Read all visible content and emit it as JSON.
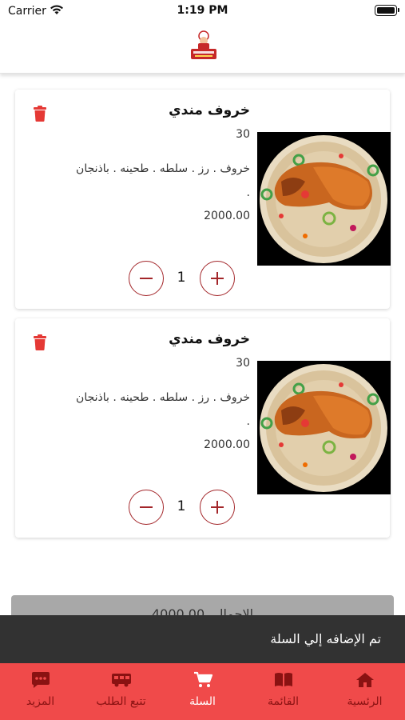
{
  "status_bar": {
    "carrier": "Carrier",
    "time": "1:19 PM"
  },
  "header": {
    "logo_icon": "restaurant-logo"
  },
  "cart_items": [
    {
      "title": "خروف مندي",
      "qty_label": "30",
      "description": "خروف . رز . سلطه . طحينه . باذنجان .",
      "price": "2000.00",
      "quantity": "1"
    },
    {
      "title": "خروف مندي",
      "qty_label": "30",
      "description": "خروف . رز . سلطه . طحينه . باذنجان .",
      "price": "2000.00",
      "quantity": "1"
    }
  ],
  "total_bar": {
    "text": "الاجمالي 4000.00"
  },
  "toast": {
    "message": "تم الإضافه إلي السلة"
  },
  "tab_bar": {
    "tabs": [
      {
        "label": "المزيد",
        "icon": "more-icon"
      },
      {
        "label": "تتبع الطلب",
        "icon": "truck-icon"
      },
      {
        "label": "السلة",
        "icon": "cart-icon",
        "active": true
      },
      {
        "label": "القائمة",
        "icon": "book-icon"
      },
      {
        "label": "الرئسية",
        "icon": "home-icon"
      }
    ]
  },
  "colors": {
    "accent_red": "#f04a4a",
    "button_outline": "#a3262a",
    "delete_red": "#e53935",
    "toast_bg": "#323232"
  }
}
